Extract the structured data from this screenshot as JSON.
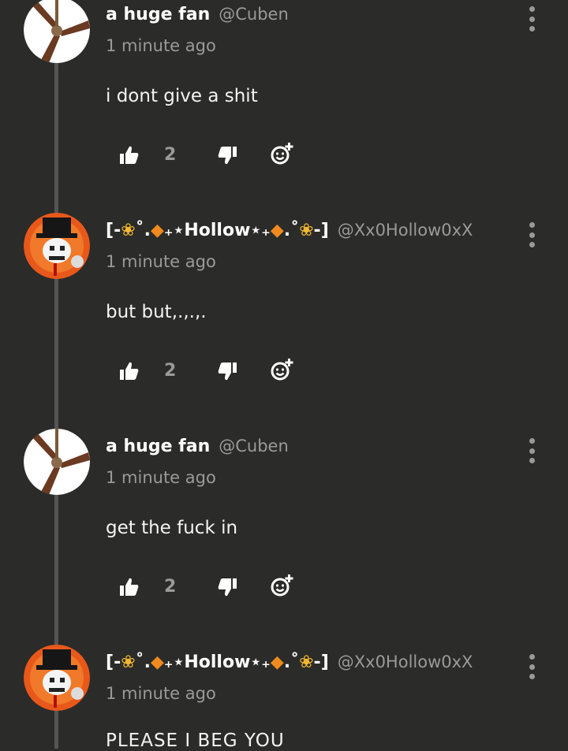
{
  "comments": [
    {
      "avatar_icon": "ceiling-fan-avatar",
      "name": "a huge fan",
      "handle": "@Cuben",
      "time": "1 minute ago",
      "text": "i dont give a shit",
      "likes": "2"
    },
    {
      "avatar_icon": "top-hat-skull-avatar",
      "name": "[-❀˚.◆₊⋆Hollow⋆₊◆.˚❀-]",
      "handle": "@Xx0Hollow0xX",
      "time": "1 minute ago",
      "text": "but but,.,.,.",
      "likes": "2"
    },
    {
      "avatar_icon": "ceiling-fan-avatar",
      "name": "a huge fan",
      "handle": "@Cuben",
      "time": "1 minute ago",
      "text": "get the fuck in",
      "likes": "2"
    },
    {
      "avatar_icon": "top-hat-skull-avatar",
      "name": "[-❀˚.◆₊⋆Hollow⋆₊◆.˚❀-]",
      "handle": "@Xx0Hollow0xX",
      "time": "1 minute ago",
      "text": "PLEASE I BEG YOU"
    }
  ],
  "colors": {
    "background": "#2b2b29",
    "muted": "#9a9a98",
    "thread_line": "#555553"
  }
}
